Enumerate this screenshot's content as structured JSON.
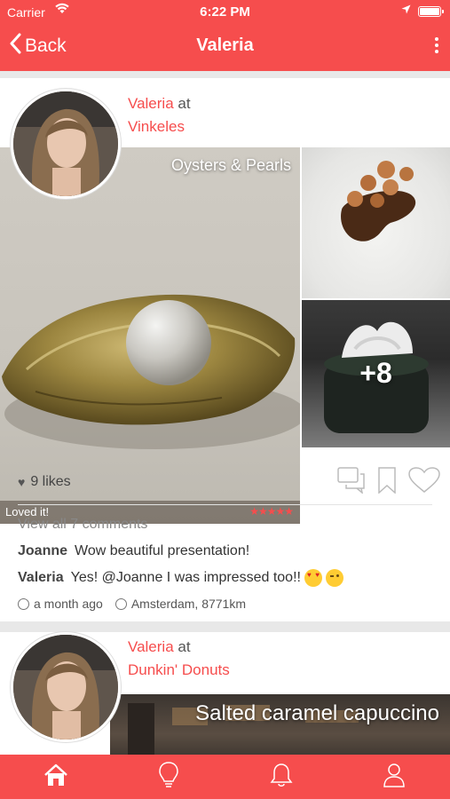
{
  "status": {
    "carrier": "Carrier",
    "time": "6:22 PM"
  },
  "nav": {
    "back_label": "Back",
    "title": "Valeria"
  },
  "posts": [
    {
      "user": "Valeria",
      "at_word": "at",
      "place": "Vinkeles",
      "photo_title": "Oysters & Pearls",
      "caption": "Loved it!",
      "rating": 5,
      "stars": "★★★★★",
      "more_count": "+8",
      "likes": "9 likes",
      "view_all": "View all 7 comments",
      "comments": [
        {
          "user": "Joanne",
          "text": "Wow beautiful presentation!"
        },
        {
          "user": "Valeria",
          "text": "Yes! @Joanne I was impressed too!!"
        }
      ],
      "time_ago": "a month ago",
      "location": "Amsterdam, 8771km"
    },
    {
      "user": "Valeria",
      "at_word": "at",
      "place": "Dunkin' Donuts",
      "photo_title": "Salted caramel capuccino"
    }
  ],
  "tabs": [
    "home-icon",
    "lightbulb-icon",
    "bell-icon",
    "profile-icon"
  ],
  "colors": {
    "accent": "#f64d4d"
  }
}
